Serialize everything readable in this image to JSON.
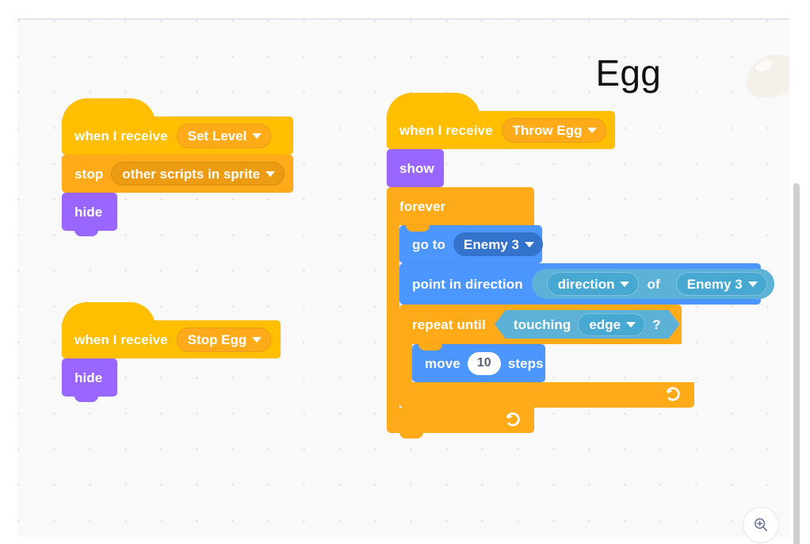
{
  "workspace": {
    "sprite_name": "Egg",
    "watermark_icon": "egg-sprite-watermark"
  },
  "scripts": [
    {
      "id": "set-level",
      "blocks": [
        {
          "type": "hat",
          "category": "events",
          "label": "when I receive",
          "dropdown": "Set Level"
        },
        {
          "type": "stack",
          "category": "control",
          "label": "stop",
          "dropdown": "other scripts in sprite"
        },
        {
          "type": "stack",
          "category": "looks",
          "label": "hide"
        }
      ]
    },
    {
      "id": "stop-egg",
      "blocks": [
        {
          "type": "hat",
          "category": "events",
          "label": "when I receive",
          "dropdown": "Stop Egg"
        },
        {
          "type": "stack",
          "category": "looks",
          "label": "hide"
        }
      ]
    },
    {
      "id": "throw-egg",
      "blocks": [
        {
          "type": "hat",
          "category": "events",
          "label": "when I receive",
          "dropdown": "Throw Egg"
        },
        {
          "type": "stack",
          "category": "looks",
          "label": "show"
        },
        {
          "type": "c",
          "category": "control",
          "label": "forever"
        },
        {
          "type": "stack",
          "category": "motion",
          "label": "go to",
          "dropdown": "Enemy 3"
        },
        {
          "type": "stack",
          "category": "motion",
          "label": "point in direction",
          "reporter": {
            "property": "direction",
            "connector": "of",
            "target": "Enemy 3"
          }
        },
        {
          "type": "c",
          "category": "control",
          "label": "repeat until",
          "condition": {
            "label": "touching",
            "dropdown": "edge",
            "suffix": "?"
          }
        },
        {
          "type": "stack",
          "category": "motion",
          "label_before": "move",
          "value": "10",
          "label_after": "steps"
        }
      ]
    }
  ],
  "palette": {
    "events": "#FFBF00",
    "control": "#FFAB19",
    "looks": "#9966FF",
    "motion": "#4C97FF",
    "sensing": "#5CB1D6",
    "canvas_bg": "#F9F9F9"
  },
  "controls": {
    "zoom_in_icon": "zoom-in-icon"
  }
}
